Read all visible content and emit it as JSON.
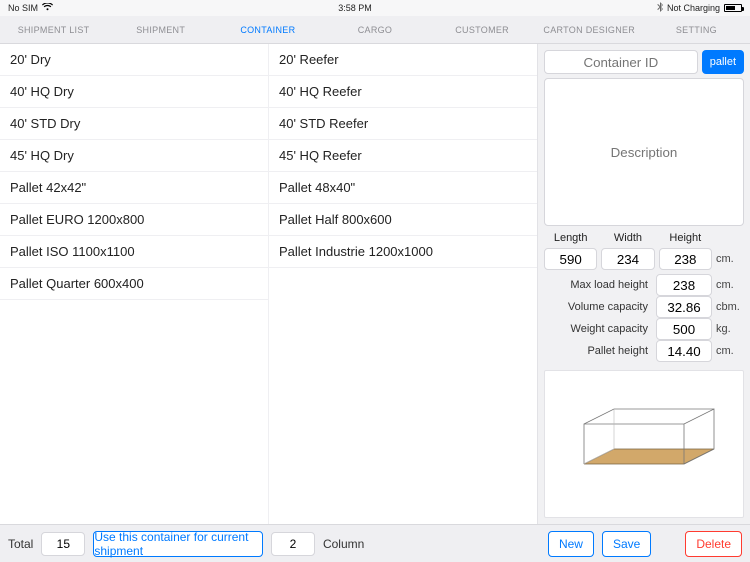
{
  "status": {
    "sim": "No SIM",
    "time": "3:58 PM",
    "charge": "Not Charging"
  },
  "tabs": [
    "SHIPMENT LIST",
    "SHIPMENT",
    "CONTAINER",
    "CARGO",
    "CUSTOMER",
    "CARTON DESIGNER",
    "SETTING"
  ],
  "activeTab": 2,
  "list": {
    "left": [
      "20' Dry",
      "40' HQ Dry",
      "40' STD Dry",
      "45' HQ Dry",
      "Pallet 42x42\"",
      "Pallet EURO 1200x800",
      "Pallet ISO 1100x1100",
      "Pallet Quarter 600x400"
    ],
    "right": [
      "20' Reefer",
      "40' HQ Reefer",
      "40' STD Reefer",
      "45' HQ Reefer",
      "Pallet 48x40\"",
      "Pallet Half 800x600",
      "Pallet Industrie 1200x1000"
    ]
  },
  "side": {
    "id_placeholder": "Container ID",
    "pallet_btn": "pallet",
    "desc_placeholder": "Description",
    "dims": {
      "length_label": "Length",
      "width_label": "Width",
      "height_label": "Height",
      "length": "590",
      "width": "234",
      "height": "238",
      "unit": "cm."
    },
    "props": [
      {
        "label": "Max load height",
        "value": "238",
        "unit": "cm."
      },
      {
        "label": "Volume capacity",
        "value": "32.86",
        "unit": "cbm."
      },
      {
        "label": "Weight capacity",
        "value": "500",
        "unit": "kg."
      },
      {
        "label": "Pallet height",
        "value": "14.40",
        "unit": "cm."
      }
    ]
  },
  "footer": {
    "total_label": "Total",
    "total": "15",
    "use_label": "Use this container for current shipment",
    "col_value": "2",
    "col_label": "Column",
    "new": "New",
    "save": "Save",
    "delete": "Delete"
  }
}
